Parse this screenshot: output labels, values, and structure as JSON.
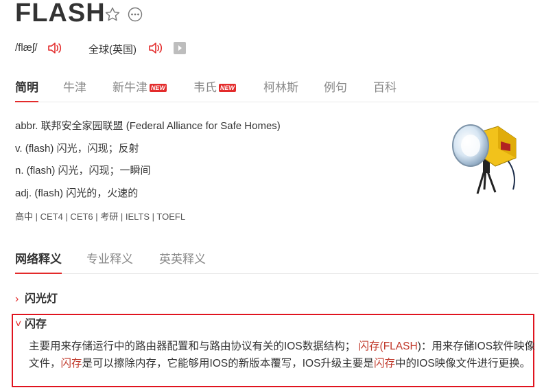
{
  "header": {
    "word": "FLASH",
    "phonetic_us": "/flæʃ/",
    "region_label": "全球(英国)"
  },
  "tabs": [
    "简明",
    "牛津",
    "新牛津",
    "韦氏",
    "柯林斯",
    "例句",
    "百科"
  ],
  "new_badge": "NEW",
  "definitions": [
    "abbr. 联邦安全家园联盟 (Federal Alliance for Safe Homes)",
    "v. (flash) 闪光，闪现；反射",
    "n. (flash) 闪光，闪现；一瞬间",
    "adj. (flash) 闪光的，火速的"
  ],
  "exam_tags": "高中 | CET4 | CET6 | 考研 | IELTS | TOEFL",
  "sub_tabs": [
    "网络释义",
    "专业释义",
    "英英释义"
  ],
  "web_senses": [
    {
      "title": "闪光灯",
      "expanded": false
    },
    {
      "title": "闪存",
      "expanded": true
    }
  ],
  "sense_detail": {
    "t1": "主要用来存储运行中的路由器配置和与路由协议有关的IOS数据结构；",
    "h1": "闪存",
    "t2": "(",
    "h2": "FLASH",
    "t3": ")：用来存储IOS软件映像文件，",
    "h3": "闪存",
    "t4": "是可以擦除内存，它能够用IOS的新版本覆写，IOS升级主要是",
    "h4": "闪存",
    "t5": "中的IOS映像文件进行更换。"
  },
  "colors": {
    "accent": "#e32b2b",
    "box": "#e0141f"
  }
}
